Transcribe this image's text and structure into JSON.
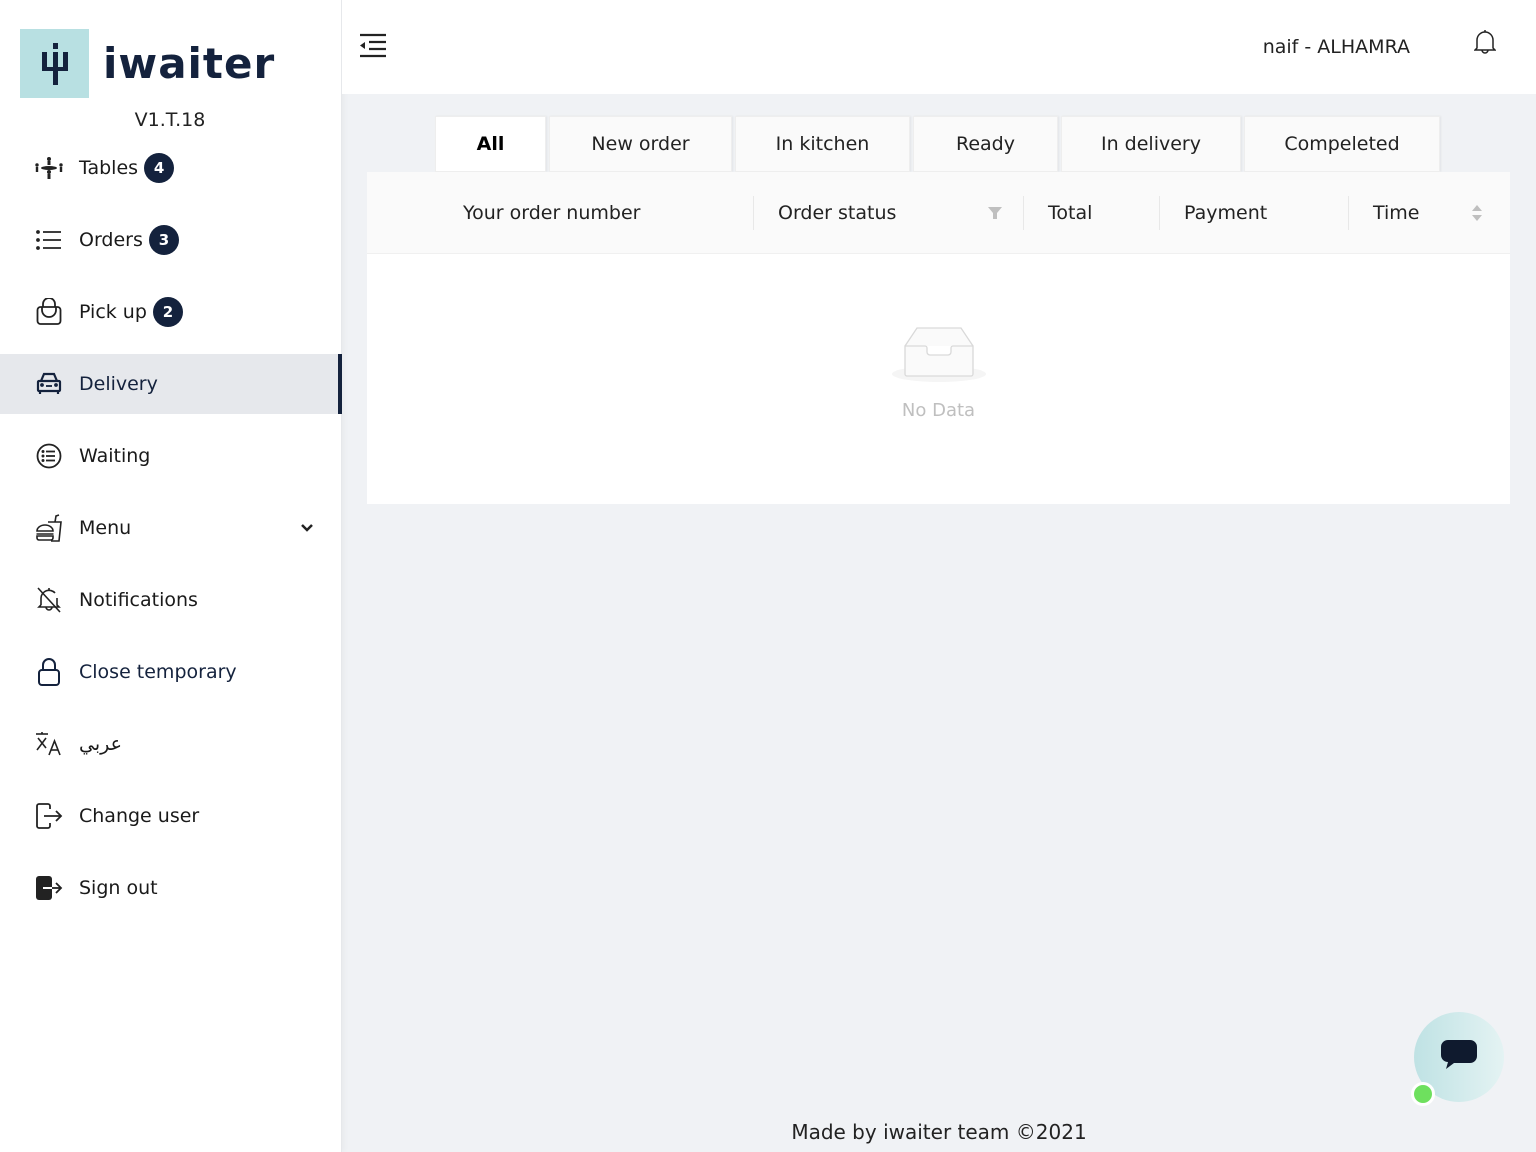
{
  "app": {
    "logo_text": "iwaiter",
    "version": "V1.T.18"
  },
  "sidebar": {
    "items": [
      {
        "label": "Tables",
        "icon": "dining-table-icon",
        "badge": "4"
      },
      {
        "label": "Orders",
        "icon": "list-icon",
        "badge": "3"
      },
      {
        "label": "Pick up",
        "icon": "shopping-bag-icon",
        "badge": "2"
      },
      {
        "label": "Delivery",
        "icon": "car-icon",
        "active": true
      },
      {
        "label": "Waiting",
        "icon": "circle-list-icon"
      },
      {
        "label": "Menu",
        "icon": "burger-drink-icon",
        "expandable": true
      },
      {
        "label": "Notifications",
        "icon": "bell-off-icon"
      },
      {
        "label": "Close temporary",
        "icon": "lock-icon"
      },
      {
        "label": "عربي",
        "icon": "translate-icon"
      },
      {
        "label": "Change user",
        "icon": "logout-outline-icon"
      },
      {
        "label": "Sign out",
        "icon": "logout-filled-icon"
      }
    ]
  },
  "header": {
    "user": "naif - ALHAMRA"
  },
  "tabs": [
    {
      "label": "All",
      "active": true
    },
    {
      "label": "New order"
    },
    {
      "label": "In kitchen"
    },
    {
      "label": "Ready"
    },
    {
      "label": "In delivery"
    },
    {
      "label": "Compeleted"
    }
  ],
  "table": {
    "columns": [
      "Your order number",
      "Order status",
      "Total",
      "Payment",
      "Time"
    ],
    "rows": [],
    "empty_text": "No Data"
  },
  "footer": {
    "text": "Made by iwaiter team ©2021"
  },
  "colors": {
    "brand_dark": "#14223d",
    "brand_light": "#b8e0e2",
    "online": "#6ee05e"
  }
}
